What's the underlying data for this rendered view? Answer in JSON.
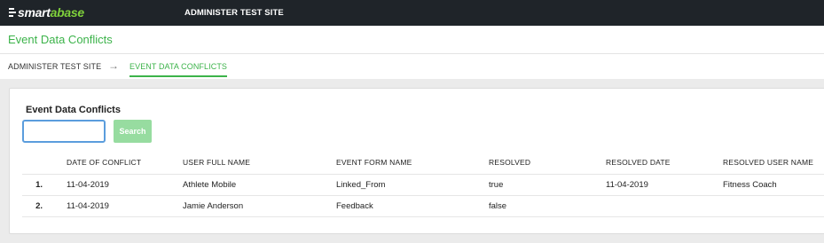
{
  "topbar": {
    "logo_smart": "smart",
    "logo_abase": "abase",
    "site_title": "ADMINISTER TEST SITE"
  },
  "header": {
    "page_title": "Event Data Conflicts"
  },
  "breadcrumb": {
    "items": [
      "ADMINISTER TEST SITE",
      "EVENT DATA CONFLICTS"
    ],
    "separator": "→"
  },
  "panel": {
    "title": "Event Data Conflicts",
    "search": {
      "value": "",
      "placeholder": ""
    },
    "search_button": "Search"
  },
  "table": {
    "columns": [
      "DATE OF CONFLICT",
      "USER FULL NAME",
      "EVENT FORM NAME",
      "RESOLVED",
      "RESOLVED DATE",
      "RESOLVED USER NAME"
    ],
    "rows": [
      {
        "num": "1.",
        "date": "11-04-2019",
        "user": "Athlete Mobile",
        "form": "Linked_From",
        "resolved": "true",
        "resolved_date": "11-04-2019",
        "resolved_user": "Fitness Coach"
      },
      {
        "num": "2.",
        "date": "11-04-2019",
        "user": "Jamie Anderson",
        "form": "Feedback",
        "resolved": "false",
        "resolved_date": "",
        "resolved_user": ""
      }
    ]
  },
  "colors": {
    "topbar": "#1f2429",
    "accent": "#3cb34a",
    "logo_green": "#7fd13b",
    "search_button": "#97dca0",
    "input_focus": "#5b9ddd"
  }
}
